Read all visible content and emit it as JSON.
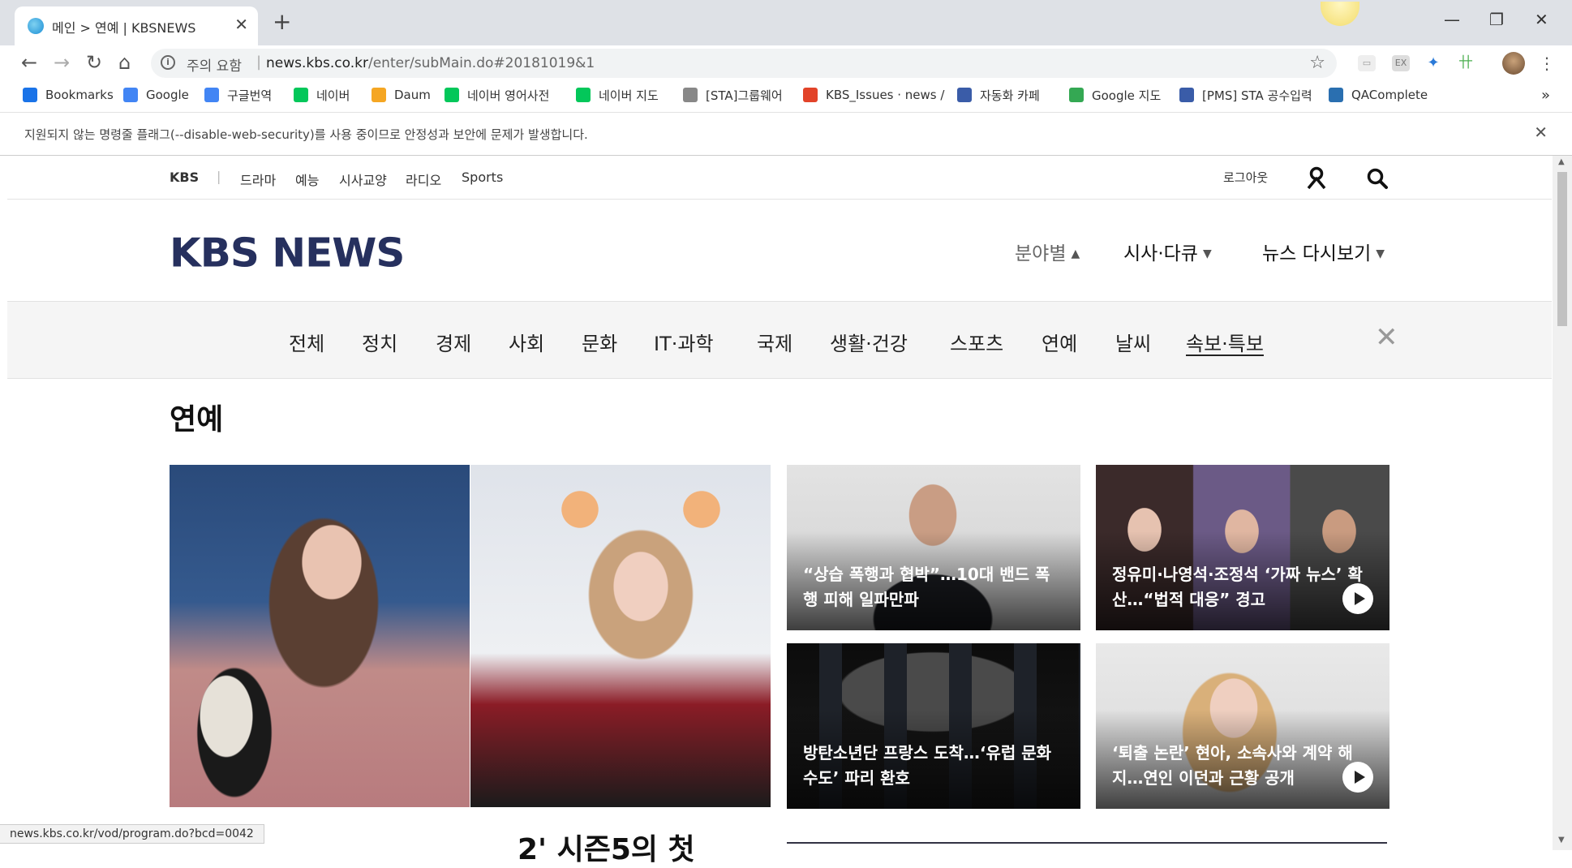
{
  "browser": {
    "tab_title": "메인 > 연예 | KBSNEWS",
    "tab_close": "✕",
    "new_tab": "+",
    "window": {
      "minimize": "—",
      "restore": "❐",
      "close": "✕"
    },
    "nav": {
      "back": "←",
      "forward": "→",
      "reload": "↻",
      "home": "⌂"
    },
    "omnibox": {
      "security_label": "주의 요함",
      "url_host": "news.kbs.co.kr",
      "url_path": "/enter/subMain.do#20181019&1"
    },
    "bookmarks": [
      {
        "label": "Bookmarks",
        "icon": "star-icon",
        "color": "#1a73e8"
      },
      {
        "label": "Google",
        "icon": "google-icon",
        "color": "#4285f4"
      },
      {
        "label": "구글번역",
        "icon": "translate-icon",
        "color": "#4285f4"
      },
      {
        "label": "네이버",
        "icon": "naver-icon",
        "color": "#03c75a"
      },
      {
        "label": "Daum",
        "icon": "daum-icon",
        "color": "#f5a623"
      },
      {
        "label": "네이버 영어사전",
        "icon": "dict-icon",
        "color": "#03c75a"
      },
      {
        "label": "네이버 지도",
        "icon": "naver-icon",
        "color": "#03c75a"
      },
      {
        "label": "[STA]그룹웨어",
        "icon": "page-icon",
        "color": "#888888"
      },
      {
        "label": "KBS_Issues · news / ",
        "icon": "gitlab-icon",
        "color": "#e24329"
      },
      {
        "label": "자동화 카페",
        "icon": "cafe-icon",
        "color": "#3a5ca8"
      },
      {
        "label": "Google 지도",
        "icon": "maps-icon",
        "color": "#34a853"
      },
      {
        "label": "[PMS] STA 공수입력",
        "icon": "pms-icon",
        "color": "#3a5ca8"
      },
      {
        "label": "QAComplete",
        "icon": "qa-icon",
        "color": "#2a6fb0"
      }
    ],
    "bookmarks_more": "»",
    "infobar_message": "지원되지 않는 명령줄 플래그(--disable-web-security)를 사용 중이므로 안정성과 보안에 문제가 발생합니다.",
    "infobar_close": "✕",
    "status_url": "news.kbs.co.kr/vod/program.do?bcd=0042"
  },
  "site": {
    "topnav": {
      "brand": "KBS",
      "divider": "|",
      "items": [
        "드라마",
        "예능",
        "시사교양",
        "라디오",
        "Sports"
      ],
      "logout": "로그아웃"
    },
    "logo": "KBS NEWS",
    "header_menu": [
      {
        "label": "분야별",
        "caret": "▲"
      },
      {
        "label": "시사·다큐",
        "caret": "▼"
      },
      {
        "label": "뉴스 다시보기",
        "caret": "▼"
      }
    ],
    "categories": [
      "전체",
      "정치",
      "경제",
      "사회",
      "문화",
      "IT·과학",
      "국제",
      "생활·건강",
      "스포츠",
      "연예",
      "날씨",
      "속보·특보"
    ],
    "category_close": "✕",
    "section_title": "연예",
    "articles": [
      {
        "caption": "“상습 폭행과 협박”…10대 밴드 폭행 피해 일파만파",
        "video": false
      },
      {
        "caption": "정유미·나영석·조정석 ‘가짜 뉴스’ 확산…“법적 대응” 경고",
        "video": true
      },
      {
        "caption": "방탄소년단 프랑스 도착…‘유럽 문화수도’ 파리 환호",
        "video": false
      },
      {
        "caption": "‘퇴출 논란’ 현아, 소속사와 계약 해지…연인 이던과 근황 공개",
        "video": true
      }
    ],
    "partial_headline": "2' 시즌5의 첫"
  },
  "colors": {
    "logo": "#26305e",
    "tabstrip": "#dee1e6",
    "category_bar": "#f5f5f5"
  }
}
